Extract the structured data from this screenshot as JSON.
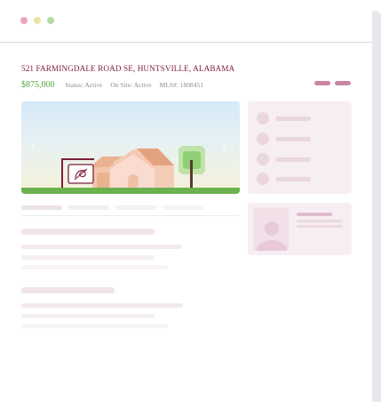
{
  "window": {
    "controls": [
      "close",
      "minimize",
      "maximize"
    ],
    "control_colors": [
      "#eaa7b7",
      "#ede2a6",
      "#b5dca6"
    ]
  },
  "listing": {
    "address": "521 FARMINGDALE ROAD SE, HUNTSVILLE, ALABAMA",
    "price": "$875,000",
    "status": "Status: Active",
    "on_site": "On Site: Active",
    "mls": "MLS#: 1808451"
  },
  "gallery": {
    "prev_glyph": "‹",
    "next_glyph": "›",
    "icons": [
      "house-icon",
      "tree-icon",
      "for-sale-sign-icon"
    ]
  },
  "colors": {
    "accent": "#7a1f3a",
    "price": "#58a63d",
    "action_pill": "#c985a3",
    "skeleton": "#eeeaf0",
    "grass": "#6cb150"
  }
}
